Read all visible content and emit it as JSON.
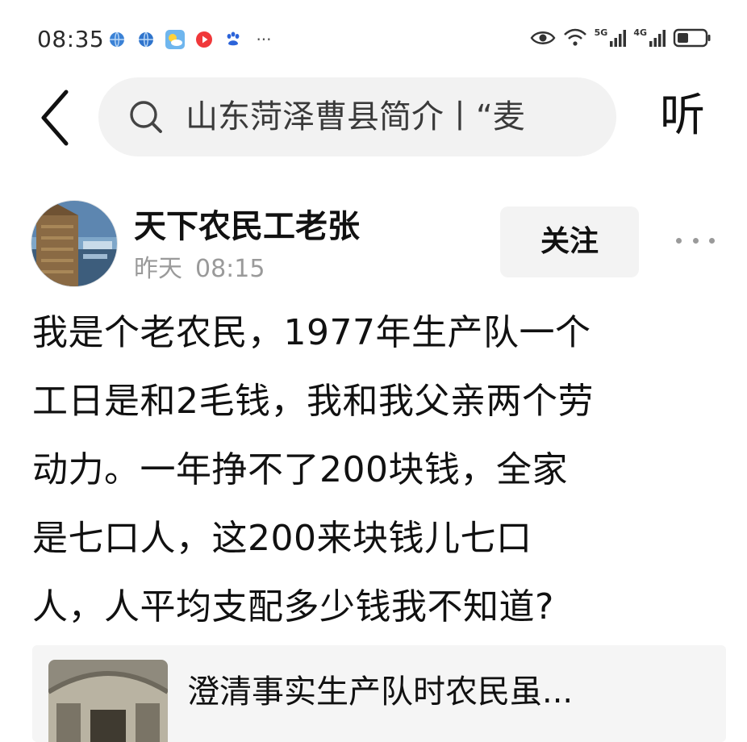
{
  "status_bar": {
    "time": "08:35",
    "notification_icons": [
      "globe-icon",
      "globe-icon",
      "weather-icon",
      "video-icon",
      "baidu-paw-icon"
    ],
    "overflow": "···",
    "network_1": "5G",
    "network_2": "4G"
  },
  "header": {
    "search_text": "山东菏泽曹县简介丨“麦",
    "listen_label": "听"
  },
  "post": {
    "author": "天下农民工老张",
    "date": "昨天",
    "time": "08:15",
    "follow_label": "关注",
    "lines": [
      "我是个老农民，1977年生产队一个",
      "工日是和2毛钱，我和我父亲两个劳",
      "动力。一年挣不了200块钱，全家",
      "是七口人，这200来块钱儿七口",
      "人，人平均支配多少钱我不知道?"
    ]
  },
  "related": {
    "title": "澄清事实生产队时农民虽..."
  },
  "colors": {
    "background": "#ffffff",
    "search_bg": "#f2f2f2",
    "follow_bg": "#f3f3f3",
    "meta_text": "#9a9a9a"
  }
}
